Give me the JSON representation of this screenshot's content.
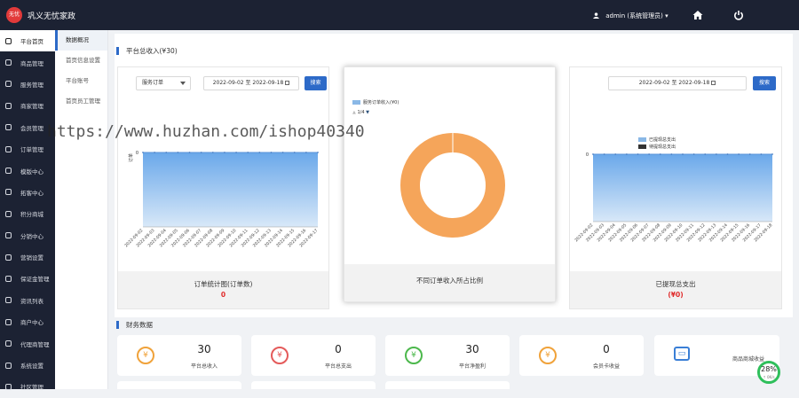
{
  "header": {
    "logo_text": "无忧",
    "title": "巩义无忧家政",
    "user_label": "admin (系统管理员)",
    "home_icon": "home-icon",
    "power_icon": "power-icon"
  },
  "sidebar": {
    "items": [
      {
        "label": "平台首页",
        "active": true
      },
      {
        "label": "商品管理"
      },
      {
        "label": "服务管理"
      },
      {
        "label": "商家管理"
      },
      {
        "label": "会员管理"
      },
      {
        "label": "订单管理"
      },
      {
        "label": "模版中心"
      },
      {
        "label": "拓客中心"
      },
      {
        "label": "积分商城"
      },
      {
        "label": "分销中心"
      },
      {
        "label": "营销设置"
      },
      {
        "label": "保证金管理"
      },
      {
        "label": "资讯列表"
      },
      {
        "label": "商户中心"
      },
      {
        "label": "代理商管理"
      },
      {
        "label": "系统设置"
      },
      {
        "label": "社区管理"
      }
    ]
  },
  "subnav": {
    "items": [
      {
        "label": "数据概况",
        "active": true
      },
      {
        "label": "首页信息设置"
      },
      {
        "label": "平台账号"
      },
      {
        "label": "首页员工管理"
      }
    ]
  },
  "income": {
    "title": "平台总收入(¥30)"
  },
  "order_card": {
    "select_value": "服务订单",
    "date_range": "2022-09-02 至 2022-09-18",
    "search_label": "搜索",
    "y_label": "订单",
    "y_tick": "0",
    "dates": [
      "2022-09-02",
      "2022-09-03",
      "2022-09-04",
      "2022-09-05",
      "2022-09-06",
      "2022-09-07",
      "2022-09-08",
      "2022-09-09",
      "2022-09-10",
      "2022-09-11",
      "2022-09-12",
      "2022-09-13",
      "2022-09-14",
      "2022-09-15",
      "2022-09-16",
      "2022-09-17"
    ],
    "footer_label": "订单统计图(订单数)",
    "footer_value": "0"
  },
  "pie_card": {
    "legend": "服务订单收入(¥0)",
    "pager": "1/4",
    "footer_label": "不同订单收入所占比例"
  },
  "withdraw_card": {
    "date_range": "2022-09-02 至 2022-09-18",
    "search_label": "搜索",
    "legend_items": [
      "已提现总支出",
      "待提现总支出"
    ],
    "y_tick": "0",
    "dates": [
      "2022-09-02",
      "2022-09-03",
      "2022-09-04",
      "2022-09-05",
      "2022-09-06",
      "2022-09-07",
      "2022-09-08",
      "2022-09-09",
      "2022-09-10",
      "2022-09-11",
      "2022-09-12",
      "2022-09-13",
      "2022-09-14",
      "2022-09-15",
      "2022-09-16",
      "2022-09-17",
      "2022-09-18"
    ],
    "footer_label": "已提现总支出",
    "footer_value": "(¥0)"
  },
  "finance": {
    "title": "财务数据",
    "stats": [
      {
        "value": "30",
        "label": "平台总收入",
        "icon": "yuan-icon",
        "color": "#f0a23a"
      },
      {
        "value": "0",
        "label": "平台总支出",
        "icon": "yuan-icon",
        "color": "#e45a5a"
      },
      {
        "value": "30",
        "label": "平台净盈利",
        "icon": "money-bag-icon",
        "color": "#4cb84c"
      },
      {
        "value": "0",
        "label": "会员卡收益",
        "icon": "diamond-yuan-icon",
        "color": "#f0a23a"
      },
      {
        "value": "",
        "label": "商品商城收益",
        "icon": "shop-icon",
        "color": "#3a7fd6"
      }
    ]
  },
  "watermark": "https://www.huzhan.com/ishop40340",
  "perf_badge": {
    "value": "28%",
    "sub": "↑ 0K/s"
  },
  "chart_data": [
    {
      "type": "area",
      "x": [
        "2022-09-02",
        "2022-09-03",
        "2022-09-04",
        "2022-09-05",
        "2022-09-06",
        "2022-09-07",
        "2022-09-08",
        "2022-09-09",
        "2022-09-10",
        "2022-09-11",
        "2022-09-12",
        "2022-09-13",
        "2022-09-14",
        "2022-09-15",
        "2022-09-16",
        "2022-09-17"
      ],
      "series": [
        {
          "values": [
            0,
            0,
            0,
            0,
            0,
            0,
            0,
            0,
            0,
            0,
            0,
            0,
            0,
            0,
            0,
            0
          ]
        }
      ],
      "ylabel": "订单",
      "ylim": [
        0,
        0
      ],
      "grid": false
    },
    {
      "type": "pie",
      "donut": true,
      "categories": [
        "服务订单收入(¥0)"
      ],
      "values": [
        1
      ],
      "colors": [
        "#f5a55a"
      ]
    },
    {
      "type": "area",
      "x": [
        "2022-09-02",
        "2022-09-03",
        "2022-09-04",
        "2022-09-05",
        "2022-09-06",
        "2022-09-07",
        "2022-09-08",
        "2022-09-09",
        "2022-09-10",
        "2022-09-11",
        "2022-09-12",
        "2022-09-13",
        "2022-09-14",
        "2022-09-15",
        "2022-09-16",
        "2022-09-17",
        "2022-09-18"
      ],
      "series": [
        {
          "name": "已提现总支出",
          "values": [
            0,
            0,
            0,
            0,
            0,
            0,
            0,
            0,
            0,
            0,
            0,
            0,
            0,
            0,
            0,
            0,
            0
          ]
        },
        {
          "name": "待提现总支出",
          "values": [
            0,
            0,
            0,
            0,
            0,
            0,
            0,
            0,
            0,
            0,
            0,
            0,
            0,
            0,
            0,
            0,
            0
          ]
        }
      ],
      "ylim": [
        0,
        0
      ],
      "legend": "top-center"
    }
  ]
}
